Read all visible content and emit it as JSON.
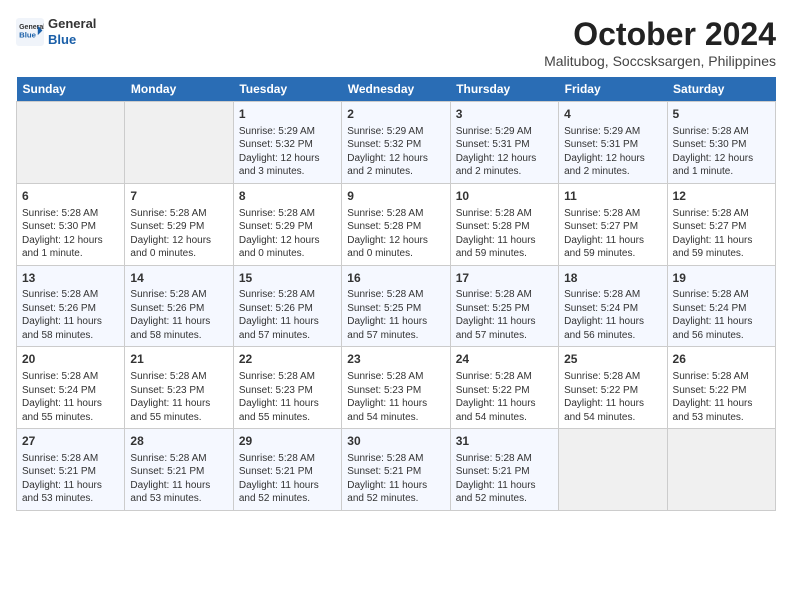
{
  "header": {
    "logo_line1": "General",
    "logo_line2": "Blue",
    "month": "October 2024",
    "location": "Malitubog, Soccsksargen, Philippines"
  },
  "weekdays": [
    "Sunday",
    "Monday",
    "Tuesday",
    "Wednesday",
    "Thursday",
    "Friday",
    "Saturday"
  ],
  "weeks": [
    [
      {
        "day": "",
        "info": ""
      },
      {
        "day": "",
        "info": ""
      },
      {
        "day": "1",
        "info": "Sunrise: 5:29 AM\nSunset: 5:32 PM\nDaylight: 12 hours and 3 minutes."
      },
      {
        "day": "2",
        "info": "Sunrise: 5:29 AM\nSunset: 5:32 PM\nDaylight: 12 hours and 2 minutes."
      },
      {
        "day": "3",
        "info": "Sunrise: 5:29 AM\nSunset: 5:31 PM\nDaylight: 12 hours and 2 minutes."
      },
      {
        "day": "4",
        "info": "Sunrise: 5:29 AM\nSunset: 5:31 PM\nDaylight: 12 hours and 2 minutes."
      },
      {
        "day": "5",
        "info": "Sunrise: 5:28 AM\nSunset: 5:30 PM\nDaylight: 12 hours and 1 minute."
      }
    ],
    [
      {
        "day": "6",
        "info": "Sunrise: 5:28 AM\nSunset: 5:30 PM\nDaylight: 12 hours and 1 minute."
      },
      {
        "day": "7",
        "info": "Sunrise: 5:28 AM\nSunset: 5:29 PM\nDaylight: 12 hours and 0 minutes."
      },
      {
        "day": "8",
        "info": "Sunrise: 5:28 AM\nSunset: 5:29 PM\nDaylight: 12 hours and 0 minutes."
      },
      {
        "day": "9",
        "info": "Sunrise: 5:28 AM\nSunset: 5:28 PM\nDaylight: 12 hours and 0 minutes."
      },
      {
        "day": "10",
        "info": "Sunrise: 5:28 AM\nSunset: 5:28 PM\nDaylight: 11 hours and 59 minutes."
      },
      {
        "day": "11",
        "info": "Sunrise: 5:28 AM\nSunset: 5:27 PM\nDaylight: 11 hours and 59 minutes."
      },
      {
        "day": "12",
        "info": "Sunrise: 5:28 AM\nSunset: 5:27 PM\nDaylight: 11 hours and 59 minutes."
      }
    ],
    [
      {
        "day": "13",
        "info": "Sunrise: 5:28 AM\nSunset: 5:26 PM\nDaylight: 11 hours and 58 minutes."
      },
      {
        "day": "14",
        "info": "Sunrise: 5:28 AM\nSunset: 5:26 PM\nDaylight: 11 hours and 58 minutes."
      },
      {
        "day": "15",
        "info": "Sunrise: 5:28 AM\nSunset: 5:26 PM\nDaylight: 11 hours and 57 minutes."
      },
      {
        "day": "16",
        "info": "Sunrise: 5:28 AM\nSunset: 5:25 PM\nDaylight: 11 hours and 57 minutes."
      },
      {
        "day": "17",
        "info": "Sunrise: 5:28 AM\nSunset: 5:25 PM\nDaylight: 11 hours and 57 minutes."
      },
      {
        "day": "18",
        "info": "Sunrise: 5:28 AM\nSunset: 5:24 PM\nDaylight: 11 hours and 56 minutes."
      },
      {
        "day": "19",
        "info": "Sunrise: 5:28 AM\nSunset: 5:24 PM\nDaylight: 11 hours and 56 minutes."
      }
    ],
    [
      {
        "day": "20",
        "info": "Sunrise: 5:28 AM\nSunset: 5:24 PM\nDaylight: 11 hours and 55 minutes."
      },
      {
        "day": "21",
        "info": "Sunrise: 5:28 AM\nSunset: 5:23 PM\nDaylight: 11 hours and 55 minutes."
      },
      {
        "day": "22",
        "info": "Sunrise: 5:28 AM\nSunset: 5:23 PM\nDaylight: 11 hours and 55 minutes."
      },
      {
        "day": "23",
        "info": "Sunrise: 5:28 AM\nSunset: 5:23 PM\nDaylight: 11 hours and 54 minutes."
      },
      {
        "day": "24",
        "info": "Sunrise: 5:28 AM\nSunset: 5:22 PM\nDaylight: 11 hours and 54 minutes."
      },
      {
        "day": "25",
        "info": "Sunrise: 5:28 AM\nSunset: 5:22 PM\nDaylight: 11 hours and 54 minutes."
      },
      {
        "day": "26",
        "info": "Sunrise: 5:28 AM\nSunset: 5:22 PM\nDaylight: 11 hours and 53 minutes."
      }
    ],
    [
      {
        "day": "27",
        "info": "Sunrise: 5:28 AM\nSunset: 5:21 PM\nDaylight: 11 hours and 53 minutes."
      },
      {
        "day": "28",
        "info": "Sunrise: 5:28 AM\nSunset: 5:21 PM\nDaylight: 11 hours and 53 minutes."
      },
      {
        "day": "29",
        "info": "Sunrise: 5:28 AM\nSunset: 5:21 PM\nDaylight: 11 hours and 52 minutes."
      },
      {
        "day": "30",
        "info": "Sunrise: 5:28 AM\nSunset: 5:21 PM\nDaylight: 11 hours and 52 minutes."
      },
      {
        "day": "31",
        "info": "Sunrise: 5:28 AM\nSunset: 5:21 PM\nDaylight: 11 hours and 52 minutes."
      },
      {
        "day": "",
        "info": ""
      },
      {
        "day": "",
        "info": ""
      }
    ]
  ]
}
